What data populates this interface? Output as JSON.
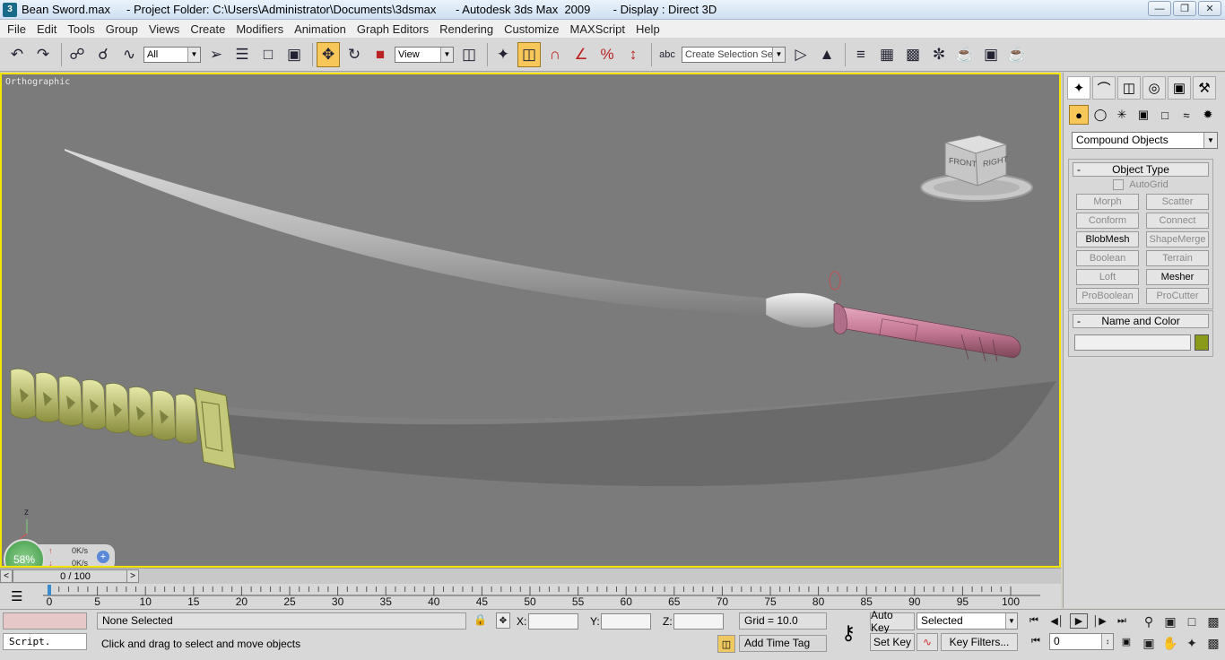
{
  "window": {
    "title": "Bean Sword.max     - Project Folder: C:\\Users\\Administrator\\Documents\\3dsmax      - Autodesk 3ds Max  2009       - Display : Direct 3D"
  },
  "menu": [
    "File",
    "Edit",
    "Tools",
    "Group",
    "Views",
    "Create",
    "Modifiers",
    "Animation",
    "Graph Editors",
    "Rendering",
    "Customize",
    "MAXScript",
    "Help"
  ],
  "toolbar": {
    "filter_value": "All",
    "ref_coord_value": "View",
    "selection_set_placeholder": "Create Selection Set"
  },
  "viewport": {
    "label": "Orthographic",
    "viewcube_front": "FRONT",
    "viewcube_right": "RIGHT",
    "axis_z": "z",
    "perf_percent": "58%",
    "perf_rate_1": "0K/s",
    "perf_rate_2": "0K/s"
  },
  "command_panel": {
    "category_value": "Compound Objects",
    "object_type_title": "Object Type",
    "autogrid_label": "AutoGrid",
    "buttons": [
      "Morph",
      "Scatter",
      "Conform",
      "Connect",
      "BlobMesh",
      "ShapeMerge",
      "Boolean",
      "Terrain",
      "Loft",
      "Mesher",
      "ProBoolean",
      "ProCutter"
    ],
    "enabled_buttons": [
      "BlobMesh",
      "Mesher"
    ],
    "name_color_title": "Name and Color",
    "object_color": "#8a9a1a"
  },
  "timeline": {
    "frame_display": "0 / 100",
    "ticks": [
      0,
      5,
      10,
      15,
      20,
      25,
      30,
      35,
      40,
      45,
      50,
      55,
      60,
      65,
      70,
      75,
      80,
      85,
      90,
      95,
      100
    ]
  },
  "status": {
    "maxscript_label": "Script.",
    "selection_text": "None Selected",
    "prompt_text": "Click and drag to select and move objects",
    "x_label": "X:",
    "y_label": "Y:",
    "z_label": "Z:",
    "grid_text": "Grid = 10.0",
    "add_time_tag": "Add Time Tag",
    "auto_key": "Auto Key",
    "set_key": "Set Key",
    "key_mode_value": "Selected",
    "key_filters": "Key Filters...",
    "current_frame": "0"
  }
}
